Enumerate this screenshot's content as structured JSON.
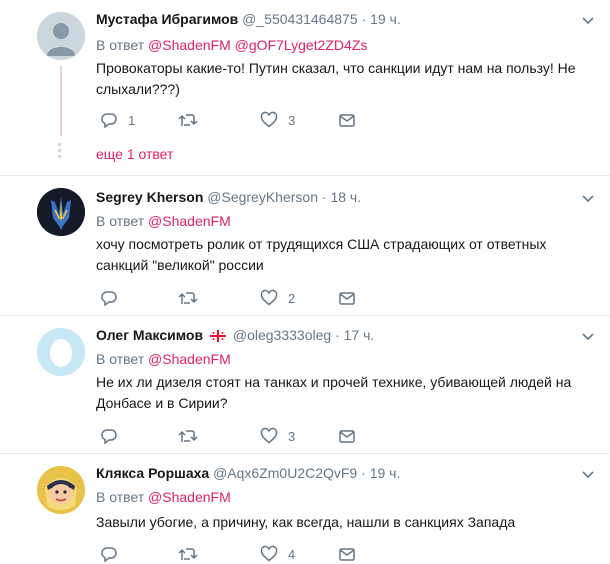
{
  "theme": {
    "accent": "#e0245e",
    "muted": "#657786",
    "text": "#14171a",
    "divider": "#e6ecf0"
  },
  "reply_prefix": "В ответ",
  "more_replies_label": "еще 1 ответ",
  "tweets": [
    {
      "name": "Мустафа Ибрагимов",
      "handle": "@_550431464875",
      "dot": "·",
      "time": "19 ч.",
      "reply_to": [
        "@ShadenFM",
        "@gOF7Lyget2ZD4Zs"
      ],
      "text": "Провокаторы какие-то! Путин сказал, что санкции идут нам на пользу! Не слыхали???)",
      "replies": "1",
      "retweets": "",
      "likes": "3",
      "avatar": "default-egg-gray"
    },
    {
      "name": "Segrey Kherson",
      "handle": "@SegreyKherson",
      "dot": "·",
      "time": "18 ч.",
      "reply_to": [
        "@ShadenFM"
      ],
      "text": "хочу посмотреть ролик от трудящихся США страдающих от ответных санкций \"великой\" россии",
      "replies": "",
      "retweets": "",
      "likes": "2",
      "avatar": "trident-emblem"
    },
    {
      "name": "Олег Максимов",
      "handle": "@oleg3333oleg",
      "dot": "·",
      "time": "17 ч.",
      "reply_to": [
        "@ShadenFM"
      ],
      "text": "Не их ли дизеля стоят на танках и прочей технике, убивающей людей на Донбасе и в Сирии?",
      "replies": "",
      "retweets": "",
      "likes": "3",
      "avatar": "default-egg-blue",
      "flag": "georgia-flag"
    },
    {
      "name": "Клякса Роршаха",
      "handle": "@Aqx6Zm0U2C2QvF9",
      "dot": "·",
      "time": "19 ч.",
      "reply_to": [
        "@ShadenFM"
      ],
      "text": "Завыли убогие, а причину, как всегда, нашли в санкциях Запада",
      "replies": "",
      "retweets": "",
      "likes": "4",
      "avatar": "cartoon-face"
    }
  ]
}
